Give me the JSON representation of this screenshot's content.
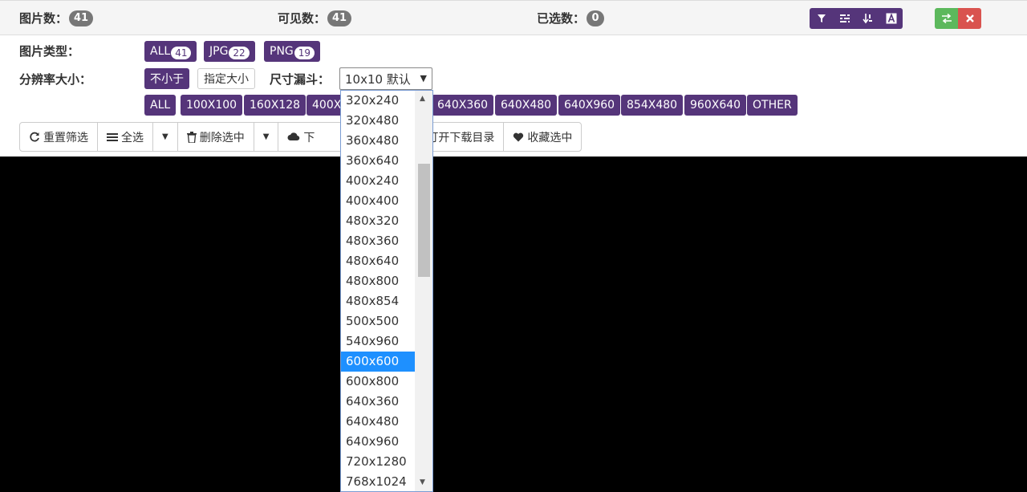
{
  "stats": {
    "total_label": "图片数：",
    "total": "41",
    "visible_label": "可见数：",
    "visible": "41",
    "selected_label": "已选数：",
    "selected": "0"
  },
  "toolbar_icons": [
    "filter-icon",
    "list-icon",
    "sort-icon",
    "font-icon",
    "swap-icon",
    "close-icon"
  ],
  "type_filter": {
    "label": "图片类型：",
    "items": [
      {
        "label": "ALL",
        "count": "41"
      },
      {
        "label": "JPG",
        "count": "22"
      },
      {
        "label": "PNG",
        "count": "19"
      }
    ]
  },
  "resolution": {
    "label": "分辨率大小：",
    "min_button": "不小于",
    "custom_button": "指定大小",
    "funnel_label": "尺寸漏斗：",
    "funnel_value": "10x10 默认",
    "presets": [
      "ALL",
      "100X100",
      "160X128",
      "400X",
      "640X360",
      "640X480",
      "640X960",
      "854X480",
      "960X640",
      "OTHER"
    ]
  },
  "actions": {
    "reset": "重置筛选",
    "select_all": "全选",
    "delete_selected": "删除选中",
    "download": "下",
    "open_folder": "打开下载目录",
    "favorite": "收藏选中"
  },
  "dropdown_options": [
    "320x240",
    "320x480",
    "360x480",
    "360x640",
    "400x240",
    "400x400",
    "480x320",
    "480x360",
    "480x640",
    "480x800",
    "480x854",
    "500x500",
    "540x960",
    "600x600",
    "600x800",
    "640x360",
    "640x480",
    "640x960",
    "720x1280",
    "768x1024"
  ],
  "dropdown_highlighted": "600x600"
}
